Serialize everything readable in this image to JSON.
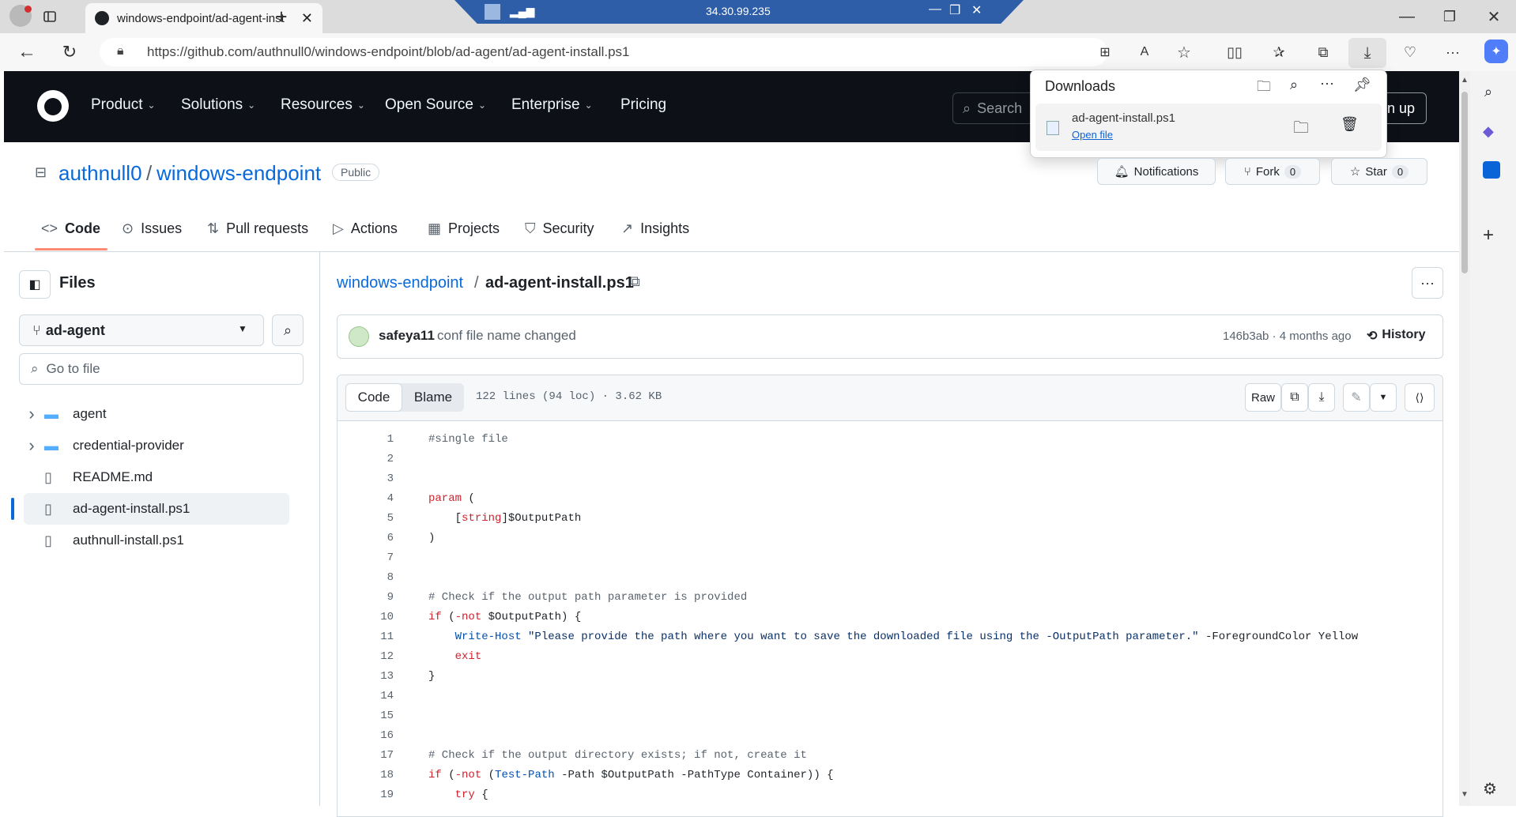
{
  "browser": {
    "tab_title": "windows-endpoint/ad-agent-inst",
    "url": "https://github.com/authnull0/windows-endpoint/blob/ad-agent/ad-agent-install.ps1",
    "remote_ip": "34.30.99.235"
  },
  "downloads": {
    "title": "Downloads",
    "file_name": "ad-agent-install.ps1",
    "open_file": "Open file"
  },
  "gh_nav": {
    "items": [
      "Product",
      "Solutions",
      "Resources",
      "Open Source",
      "Enterprise",
      "Pricing"
    ],
    "search_placeholder": "Search",
    "signup": "n up"
  },
  "repo": {
    "owner": "authnull0",
    "name": "windows-endpoint",
    "visibility": "Public",
    "notifications": "Notifications",
    "fork_label": "Fork",
    "fork_count": "0",
    "star_label": "Star",
    "star_count": "0",
    "tabs": [
      "Code",
      "Issues",
      "Pull requests",
      "Actions",
      "Projects",
      "Security",
      "Insights"
    ]
  },
  "sidebar": {
    "title": "Files",
    "branch": "ad-agent",
    "goto_placeholder": "Go to file",
    "tree": [
      {
        "name": "agent",
        "type": "folder"
      },
      {
        "name": "credential-provider",
        "type": "folder"
      },
      {
        "name": "README.md",
        "type": "file"
      },
      {
        "name": "ad-agent-install.ps1",
        "type": "file",
        "selected": true
      },
      {
        "name": "authnull-install.ps1",
        "type": "file"
      }
    ]
  },
  "file": {
    "breadcrumb_repo": "windows-endpoint",
    "breadcrumb_file": "ad-agent-install.ps1",
    "commit_author": "safeya11",
    "commit_message": "conf file name changed",
    "commit_hash": "146b3ab · 4 months ago",
    "history": "History",
    "tab_code": "Code",
    "tab_blame": "Blame",
    "meta": "122 lines (94 loc) · 3.62 KB",
    "raw": "Raw"
  },
  "code_lines": [
    {
      "n": "1",
      "html": "<span class='cmt'>#single file</span>"
    },
    {
      "n": "2",
      "html": ""
    },
    {
      "n": "3",
      "html": ""
    },
    {
      "n": "4",
      "html": "<span class='kw'>param</span> ("
    },
    {
      "n": "5",
      "html": "    [<span class='kw'>string</span>]$OutputPath"
    },
    {
      "n": "6",
      "html": ")"
    },
    {
      "n": "7",
      "html": ""
    },
    {
      "n": "8",
      "html": ""
    },
    {
      "n": "9",
      "html": "<span class='cmt'># Check if the output path parameter is provided</span>"
    },
    {
      "n": "10",
      "html": "<span class='kw'>if</span> (<span class='kw'>-not</span> $OutputPath) {"
    },
    {
      "n": "11",
      "html": "    <span class='fn'>Write-Host</span> <span class='str'>\"Please provide the path where you want to save the downloaded file using the -OutputPath parameter.\"</span> -ForegroundColor Yellow"
    },
    {
      "n": "12",
      "html": "    <span class='kw'>exit</span>"
    },
    {
      "n": "13",
      "html": "}"
    },
    {
      "n": "14",
      "html": ""
    },
    {
      "n": "15",
      "html": ""
    },
    {
      "n": "16",
      "html": ""
    },
    {
      "n": "17",
      "html": "<span class='cmt'># Check if the output directory exists; if not, create it</span>"
    },
    {
      "n": "18",
      "html": "<span class='kw'>if</span> (<span class='kw'>-not</span> (<span class='fn'>Test-Path</span> -Path $OutputPath -PathType Container)) {"
    },
    {
      "n": "19",
      "html": "    <span class='kw'>try</span> {"
    }
  ]
}
